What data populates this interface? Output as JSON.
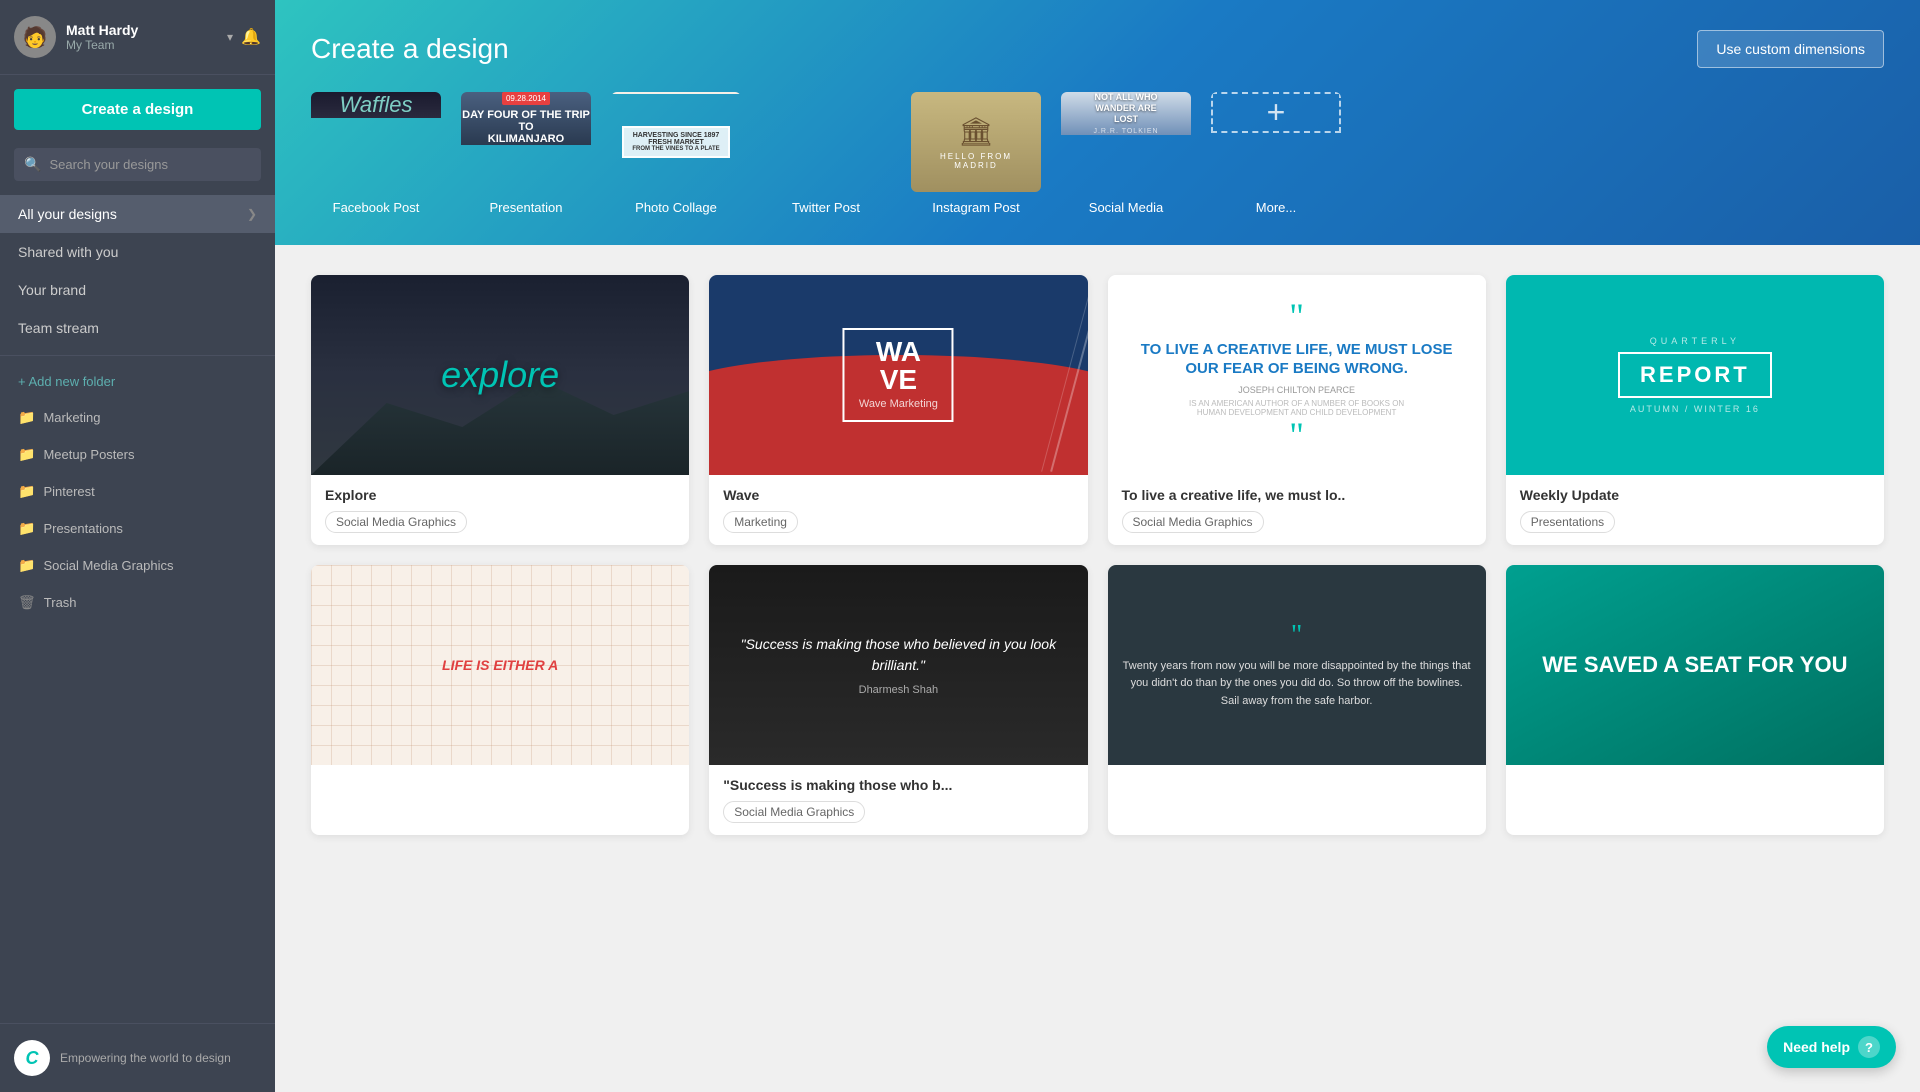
{
  "sidebar": {
    "user": {
      "name": "Matt Hardy",
      "team": "My Team"
    },
    "create_button": "Create a design",
    "search_placeholder": "Search your designs",
    "nav_items": [
      {
        "id": "all-designs",
        "label": "All your designs",
        "active": true
      },
      {
        "id": "shared",
        "label": "Shared with you"
      },
      {
        "id": "brand",
        "label": "Your brand"
      },
      {
        "id": "team-stream",
        "label": "Team stream"
      }
    ],
    "add_folder": "+ Add new folder",
    "folders": [
      {
        "id": "marketing",
        "label": "Marketing",
        "type": "folder"
      },
      {
        "id": "meetup",
        "label": "Meetup Posters",
        "type": "folder"
      },
      {
        "id": "pinterest",
        "label": "Pinterest",
        "type": "folder"
      },
      {
        "id": "presentations",
        "label": "Presentations",
        "type": "folder"
      },
      {
        "id": "social-media",
        "label": "Social Media Graphics",
        "type": "folder"
      },
      {
        "id": "trash",
        "label": "Trash",
        "type": "trash"
      }
    ],
    "footer_text": "Empowering the world to design",
    "canva_logo": "C"
  },
  "hero": {
    "title": "Create a design",
    "custom_dim_btn": "Use custom dimensions",
    "templates": [
      {
        "id": "facebook",
        "label": "Facebook Post"
      },
      {
        "id": "presentation",
        "label": "Presentation"
      },
      {
        "id": "collage",
        "label": "Photo Collage"
      },
      {
        "id": "twitter",
        "label": "Twitter Post"
      },
      {
        "id": "instagram",
        "label": "Instagram Post"
      },
      {
        "id": "social-media",
        "label": "Social Media"
      },
      {
        "id": "more",
        "label": "More..."
      }
    ]
  },
  "designs": [
    {
      "id": "explore",
      "title": "Explore",
      "tag": "Social Media Graphics",
      "type": "explore"
    },
    {
      "id": "wave",
      "title": "Wave",
      "tag": "Marketing",
      "type": "wave"
    },
    {
      "id": "creative-life",
      "title": "To live a creative life, we must lo..",
      "tag": "Social Media Graphics",
      "type": "quote"
    },
    {
      "id": "weekly-update",
      "title": "Weekly Update",
      "tag": "Presentations",
      "type": "report"
    },
    {
      "id": "map",
      "title": "",
      "tag": "",
      "type": "map"
    },
    {
      "id": "success",
      "title": "\"Success is making those who b...",
      "tag": "Social Media Graphics",
      "type": "success"
    },
    {
      "id": "twenty-years",
      "title": "",
      "tag": "",
      "type": "twenty"
    },
    {
      "id": "saved-seat",
      "title": "",
      "tag": "",
      "type": "seat"
    }
  ],
  "help": {
    "label": "Need help",
    "icon": "?"
  }
}
